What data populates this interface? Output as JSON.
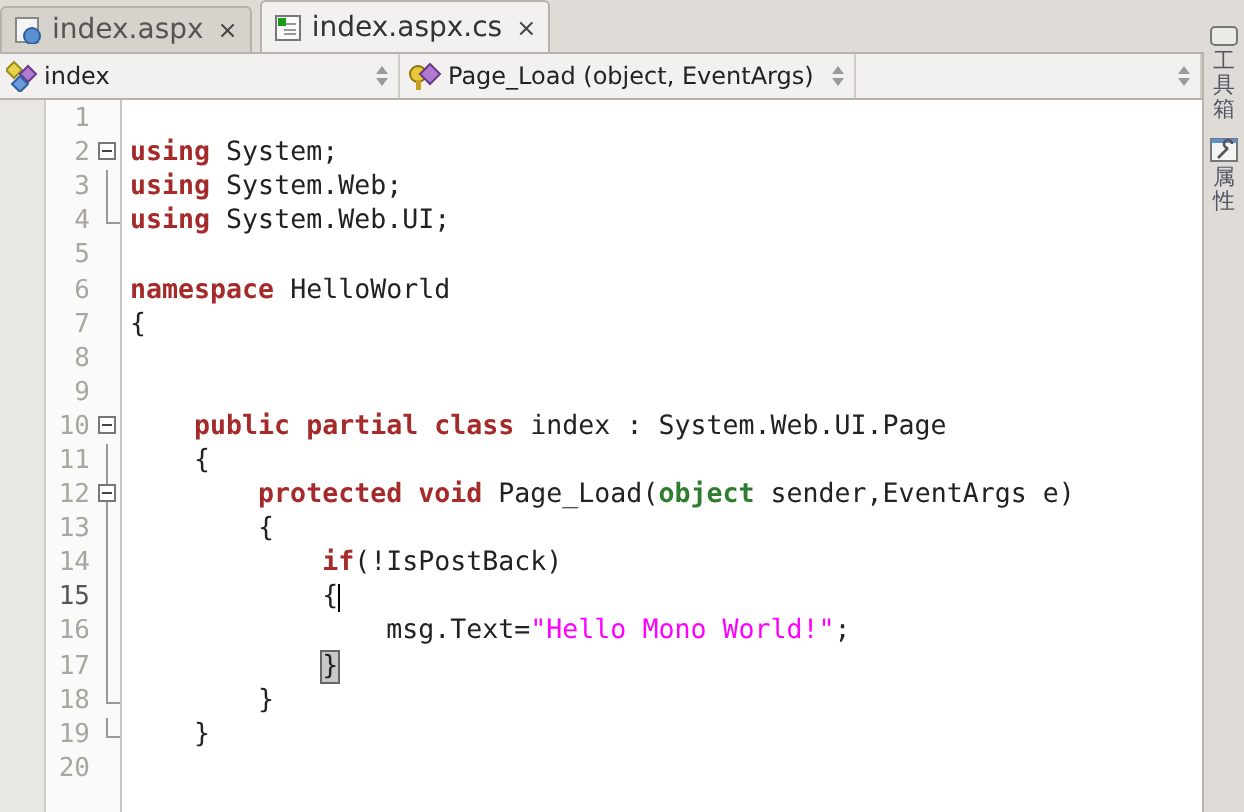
{
  "tabs": [
    {
      "label": "index.aspx",
      "selected": false,
      "close": "×"
    },
    {
      "label": "index.aspx.cs",
      "selected": true,
      "close": "×"
    }
  ],
  "navigation": [
    {
      "label": "index"
    },
    {
      "label": "Page_Load (object, EventArgs)"
    }
  ],
  "editor": {
    "lines": [
      {
        "number": "1",
        "kind": "plain",
        "current": false
      },
      {
        "number": "2",
        "kind": "fold-start",
        "current": false,
        "tokens": [
          {
            "text": "using",
            "kind": "keyword"
          },
          {
            "text": " System;",
            "kind": "plain"
          }
        ]
      },
      {
        "number": "3",
        "kind": "fold-body",
        "current": false,
        "tokens": [
          {
            "text": "using",
            "kind": "keyword"
          },
          {
            "text": " System.Web;",
            "kind": "plain"
          }
        ]
      },
      {
        "number": "4",
        "kind": "fold-end",
        "current": false,
        "tokens": [
          {
            "text": "using",
            "kind": "keyword"
          },
          {
            "text": " System.Web.UI;",
            "kind": "plain"
          }
        ]
      },
      {
        "number": "5",
        "kind": "plain",
        "current": false
      },
      {
        "number": "6",
        "kind": "plain",
        "current": false,
        "tokens": [
          {
            "text": "namespace",
            "kind": "keyword"
          },
          {
            "text": " HelloWorld",
            "kind": "plain"
          }
        ]
      },
      {
        "number": "7",
        "kind": "plain",
        "current": false,
        "tokens": [
          {
            "text": "{",
            "kind": "plain"
          }
        ]
      },
      {
        "number": "8",
        "kind": "plain",
        "current": false
      },
      {
        "number": "9",
        "kind": "plain",
        "current": false
      },
      {
        "number": "10",
        "kind": "fold-start",
        "current": false,
        "tokens": [
          {
            "text": "    public partial class",
            "kind": "keyword"
          },
          {
            "text": " index : System.Web.UI.Page",
            "kind": "plain"
          }
        ]
      },
      {
        "number": "11",
        "kind": "fold-body",
        "current": false,
        "tokens": [
          {
            "text": "    {",
            "kind": "plain"
          }
        ]
      },
      {
        "number": "12",
        "kind": "fold-start",
        "current": false,
        "tokens": [
          {
            "text": "        protected void",
            "kind": "keyword"
          },
          {
            "text": " Page_Load(",
            "kind": "plain"
          },
          {
            "text": "object",
            "kind": "type"
          },
          {
            "text": " sender,EventArgs e)",
            "kind": "plain"
          }
        ]
      },
      {
        "number": "13",
        "kind": "fold-body",
        "current": false,
        "tokens": [
          {
            "text": "        {",
            "kind": "plain"
          }
        ]
      },
      {
        "number": "14",
        "kind": "fold-body",
        "current": false,
        "tokens": [
          {
            "text": "            if",
            "kind": "keyword"
          },
          {
            "text": "(!IsPostBack)",
            "kind": "plain"
          }
        ]
      },
      {
        "number": "15",
        "kind": "fold-body",
        "current": true,
        "tokens": [
          {
            "text": "            {",
            "kind": "plain"
          }
        ]
      },
      {
        "number": "16",
        "kind": "fold-body",
        "current": false,
        "tokens": [
          {
            "text": "                msg.Text=",
            "kind": "plain"
          },
          {
            "text": "\"Hello Mono World!\"",
            "kind": "string"
          },
          {
            "text": ";",
            "kind": "plain"
          }
        ]
      },
      {
        "number": "17",
        "kind": "fold-body",
        "current": false,
        "tokens": [
          {
            "text": "            }",
            "kind": "match"
          }
        ]
      },
      {
        "number": "18",
        "kind": "fold-end",
        "current": false,
        "tokens": [
          {
            "text": "        }",
            "kind": "plain"
          }
        ]
      },
      {
        "number": "19",
        "kind": "fold-end",
        "current": false,
        "tokens": [
          {
            "text": "    }",
            "kind": "plain"
          }
        ]
      },
      {
        "number": "20",
        "kind": "plain",
        "current": false
      }
    ]
  },
  "dock": [
    {
      "label": "工具箱"
    },
    {
      "label": "属性"
    }
  ]
}
